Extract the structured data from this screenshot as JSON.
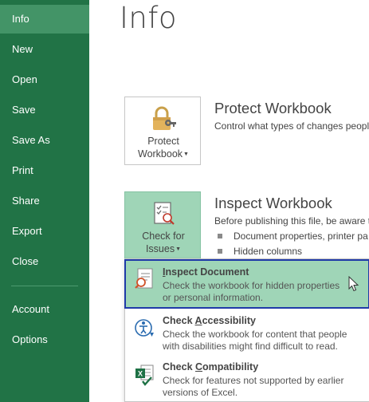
{
  "sidebar": {
    "items": [
      {
        "label": "Info"
      },
      {
        "label": "New"
      },
      {
        "label": "Open"
      },
      {
        "label": "Save"
      },
      {
        "label": "Save As"
      },
      {
        "label": "Print"
      },
      {
        "label": "Share"
      },
      {
        "label": "Export"
      },
      {
        "label": "Close"
      },
      {
        "label": "Account"
      },
      {
        "label": "Options"
      }
    ]
  },
  "main": {
    "title": "Info",
    "protect": {
      "button_line1": "Protect",
      "button_line2": "Workbook",
      "icon": "lock-key-icon",
      "heading": "Protect Workbook",
      "description": "Control what types of changes peopl"
    },
    "inspect": {
      "button_line1": "Check for",
      "button_line2": "Issues",
      "icon": "checklist-magnifier-icon",
      "heading": "Inspect Workbook",
      "description": "Before publishing this file, be aware t",
      "bullets": [
        "Document properties, printer pa",
        "Hidden columns"
      ]
    }
  },
  "menu": {
    "items": [
      {
        "title_pre": "",
        "title_ul": "I",
        "title_post": "nspect Document",
        "desc_line1": "Check the workbook for hidden properties",
        "desc_line2": "or personal information.",
        "icon": "inspect-document-icon"
      },
      {
        "title_pre": "Check ",
        "title_ul": "A",
        "title_post": "ccessibility",
        "desc_line1": "Check the workbook for content that people",
        "desc_line2": "with disabilities might find difficult to read.",
        "icon": "accessibility-checker-icon"
      },
      {
        "title_pre": "Check ",
        "title_ul": "C",
        "title_post": "ompatibility",
        "desc_line1": "Check for features not supported by earlier",
        "desc_line2": "versions of Excel.",
        "icon": "compatibility-checker-icon"
      }
    ]
  },
  "colors": {
    "sidebar_bg": "#217346",
    "sidebar_active": "#439467",
    "highlight_bg": "#9fd5b7",
    "highlight_border": "#1f3aa8"
  }
}
